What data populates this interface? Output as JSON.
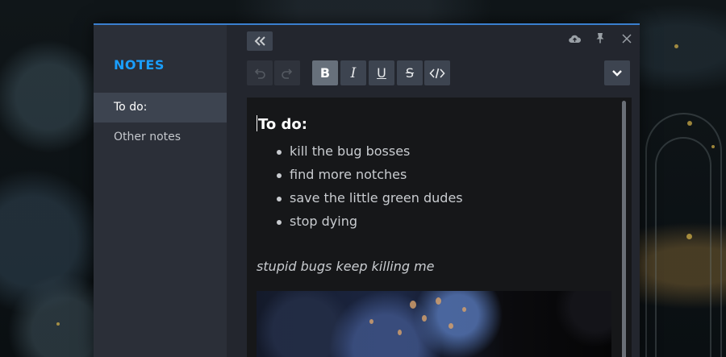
{
  "window": {
    "accent_color": "#3a7fcf"
  },
  "sidebar": {
    "title": "NOTES",
    "title_color": "#1a9fff",
    "items": [
      {
        "label": "To do:",
        "active": true
      },
      {
        "label": "Other notes",
        "active": false
      }
    ]
  },
  "titlebar": {
    "icons": [
      "upload-icon",
      "pin-icon",
      "close-icon"
    ]
  },
  "toolbar": {
    "collapse_icon": "double-chevron-left-icon",
    "buttons": [
      {
        "name": "undo",
        "icon": "undo-icon",
        "state": "disabled"
      },
      {
        "name": "redo",
        "icon": "redo-icon",
        "state": "disabled"
      },
      {
        "name": "bold",
        "label": "B",
        "state": "active"
      },
      {
        "name": "italic",
        "label": "I",
        "state": "normal"
      },
      {
        "name": "underline",
        "label": "U",
        "state": "normal"
      },
      {
        "name": "strikethrough",
        "label": "S",
        "state": "normal"
      },
      {
        "name": "code",
        "icon": "code-icon",
        "state": "normal"
      }
    ],
    "more_icon": "chevron-down-icon"
  },
  "note": {
    "heading": "To do:",
    "items": [
      "kill the bug bosses",
      "find more notches",
      "save the little green dudes",
      "stop dying"
    ],
    "italic_line": "stupid bugs keep killing me"
  }
}
